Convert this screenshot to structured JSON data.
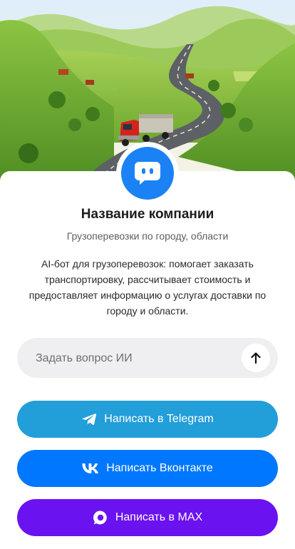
{
  "company": {
    "name": "Название компании",
    "subtitle": "Грузоперевозки по городу, области",
    "description": "AI-бот для грузоперевозок: помогает заказать транспортировку, рассчитывает стоимость и предоставляет информацию о услугах доставки по городу и области."
  },
  "ask": {
    "placeholder": "Задать вопрос ИИ"
  },
  "buttons": {
    "telegram": "Написать в Telegram",
    "vkontakte": "Написать Вконтакте",
    "max": "Написать в MAX"
  },
  "icons": {
    "avatar": "chat-bot-icon",
    "send": "arrow-up-icon",
    "telegram": "telegram-plane-icon",
    "vkontakte": "vk-logo-icon",
    "max": "max-logo-icon"
  },
  "colors": {
    "avatar": "#1a82f5",
    "telegram": "#229ed9",
    "vkontakte": "#0077ff",
    "max": "#6b12f0"
  }
}
